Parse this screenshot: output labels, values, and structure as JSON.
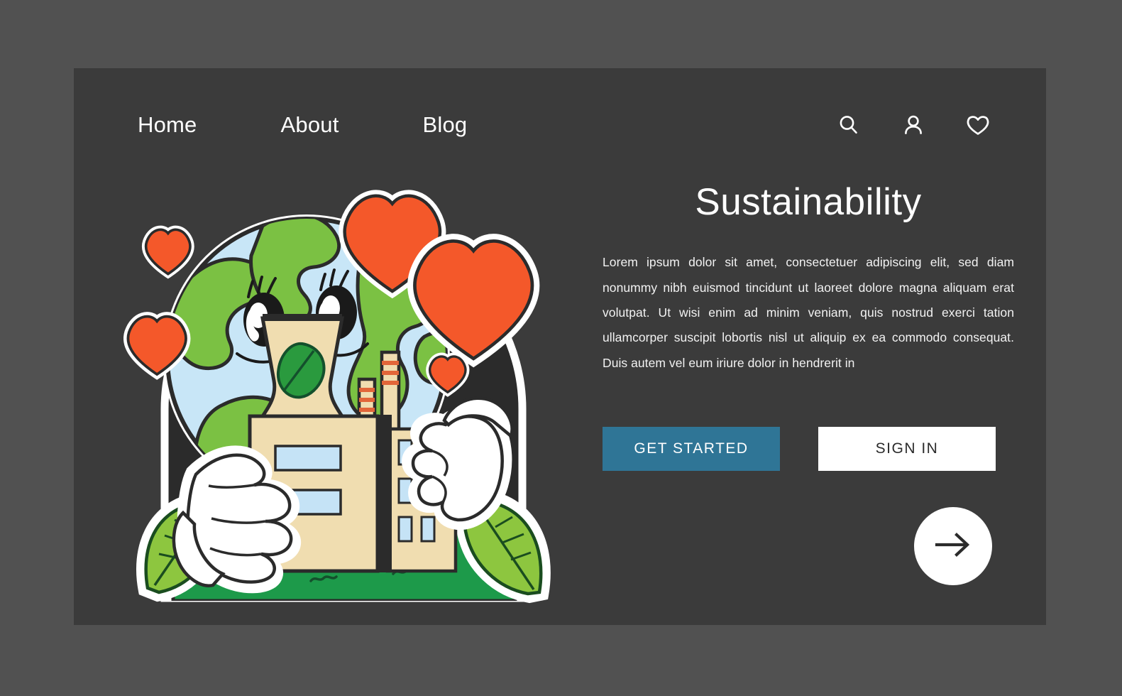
{
  "theme": {
    "page_background": "#515151",
    "card_background": "#3b3b3b",
    "accent_button": "#2f7596",
    "text_primary": "#ffffff",
    "heart_color": "#f4582a",
    "globe_green": "#7bc143",
    "globe_blue": "#c8e6f7",
    "grass_green": "#1d9a4a",
    "leaf_green": "#8dc63f",
    "building_tan": "#f0ddb0",
    "window_blue": "#c5e3f6",
    "outline_dark": "#2b2b2b"
  },
  "nav": {
    "links": [
      {
        "label": "Home"
      },
      {
        "label": "About"
      },
      {
        "label": "Blog"
      }
    ],
    "icons": [
      {
        "name": "search-icon"
      },
      {
        "name": "user-icon"
      },
      {
        "name": "heart-icon"
      }
    ]
  },
  "hero": {
    "title": "Sustainability",
    "paragraph": "Lorem ipsum dolor sit amet, consectetuer adipiscing elit, sed diam nonummy nibh euismod tincidunt ut laoreet dolore magna aliquam erat volutpat. Ut wisi enim ad minim veniam, quis nostrud exerci tation ullamcorper suscipit lobortis nisl ut aliquip ex ea commodo consequat. Duis autem vel eum iriure dolor in hendrerit in",
    "primary_button": "GET STARTED",
    "secondary_button": "SIGN IN",
    "next_button_icon": "arrow-right-icon"
  },
  "illustration": {
    "name": "earth-character-hugging-factory",
    "elements": [
      "globe-character",
      "eyes",
      "smile",
      "gloved-hands",
      "factory-building",
      "cooling-tower-leaf",
      "smokestacks",
      "grass-hill",
      "leaves",
      "hearts"
    ],
    "heart_count": 5
  }
}
